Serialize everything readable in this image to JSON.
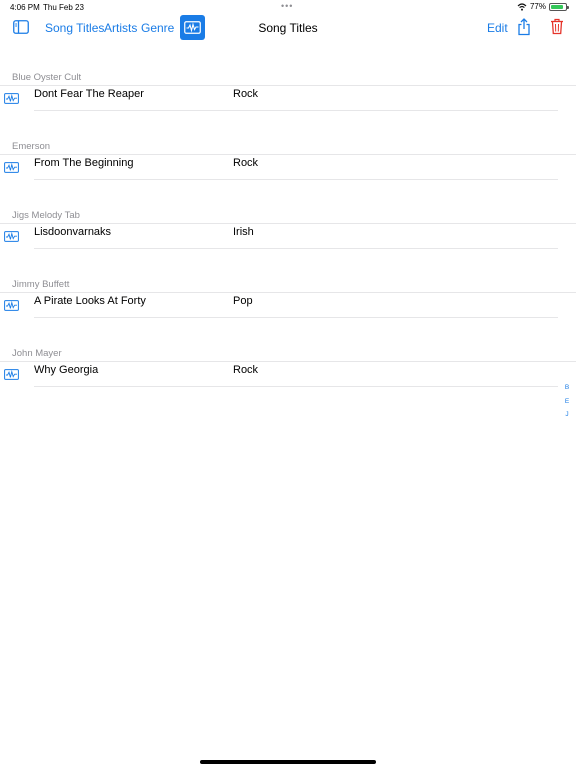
{
  "status_bar": {
    "time": "4:06 PM",
    "date": "Thu Feb 23",
    "battery": "77%"
  },
  "toolbar": {
    "song_titles_label": "Song Titles",
    "artists_label": "Artists",
    "genre_label": "Genre",
    "title": "Song Titles",
    "edit_label": "Edit"
  },
  "sections": [
    {
      "header": "Blue Oyster Cult",
      "songs": [
        {
          "title": "Dont Fear The Reaper",
          "genre": "Rock"
        }
      ]
    },
    {
      "header": "Emerson",
      "songs": [
        {
          "title": "From The Beginning",
          "genre": "Rock"
        }
      ]
    },
    {
      "header": "Jigs Melody Tab",
      "songs": [
        {
          "title": "Lisdoonvarnaks",
          "genre": "Irish"
        }
      ]
    },
    {
      "header": "Jimmy Buffett",
      "songs": [
        {
          "title": "A Pirate Looks At Forty",
          "genre": "Pop"
        }
      ]
    },
    {
      "header": "John Mayer",
      "songs": [
        {
          "title": "Why Georgia",
          "genre": "Rock"
        }
      ]
    }
  ],
  "index_letters": [
    "B",
    "E",
    "J"
  ],
  "colors": {
    "accent": "#1a7ce6",
    "delete": "#e5332a",
    "header_text": "#8e8e93",
    "battery": "#34c759"
  },
  "icons": {
    "sidebar": "sidebar-icon",
    "mode": "waveform-icon",
    "share": "share-icon",
    "trash": "trash-icon",
    "row": "waveform-icon"
  }
}
